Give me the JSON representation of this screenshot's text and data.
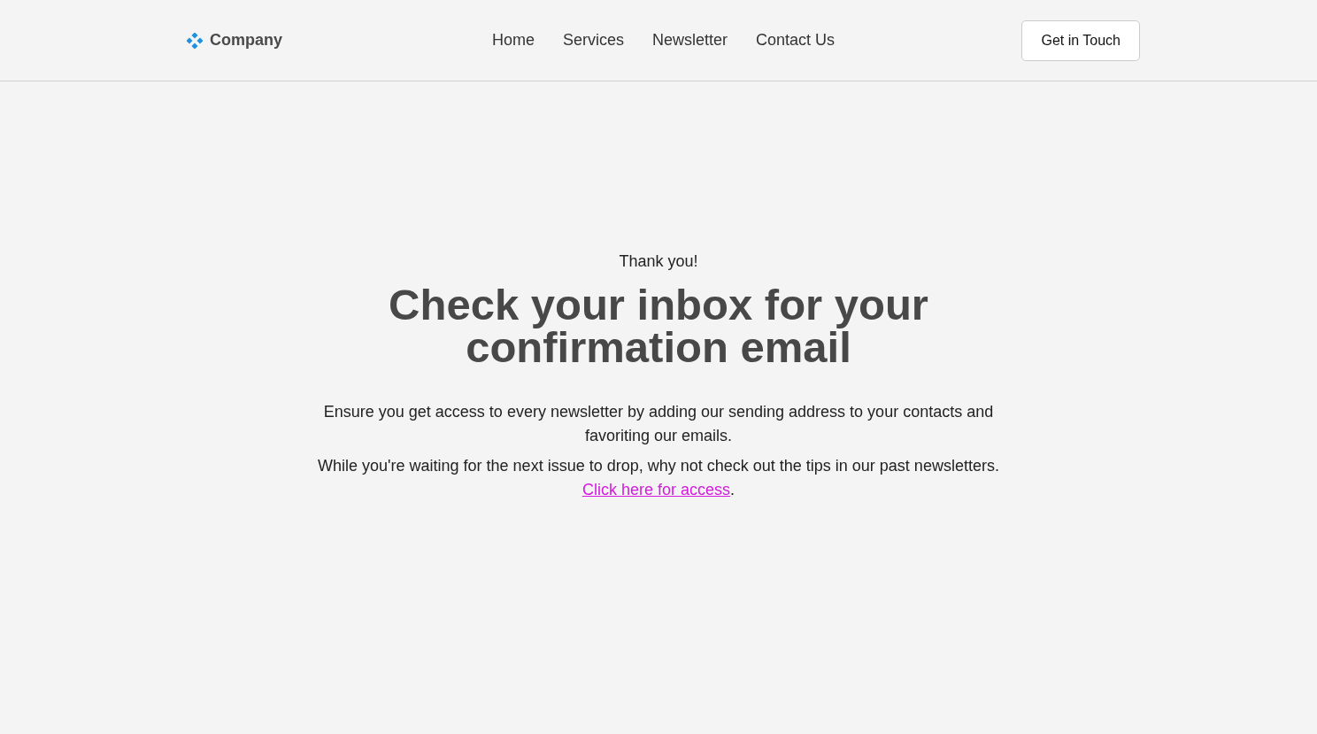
{
  "header": {
    "logo": "Company",
    "nav": [
      "Home",
      "Services",
      "Newsletter",
      "Contact Us"
    ],
    "cta": "Get in Touch"
  },
  "main": {
    "eyebrow": "Thank you!",
    "heading": "Check your inbox for your confirmation email",
    "paragraph": "Ensure you get access to every newsletter by adding our sending address to your contacts and favoriting our emails.",
    "note": {
      "text": "While you're waiting for the next issue to drop, why not check out the tips in our past newsletters. ",
      "link": "Click here for access",
      "after": "."
    }
  }
}
